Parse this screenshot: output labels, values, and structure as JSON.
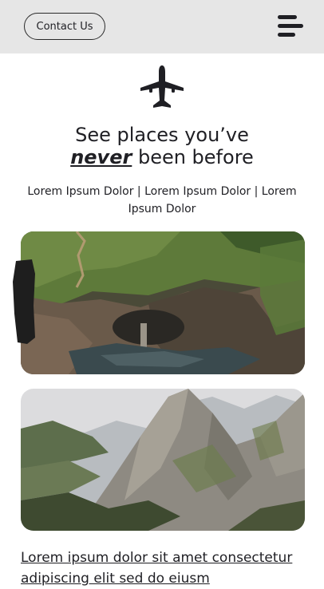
{
  "header": {
    "contact_label": "Contact Us",
    "menu_icon": "hamburger-menu-icon",
    "background": "#e6e6e6"
  },
  "hero": {
    "icon": "airplane-icon",
    "title_line1": "See places you’ve",
    "title_emphasis": "never",
    "title_rest": "been before",
    "subtitle": "Lorem Ipsum Dolor | Lorem Ipsum Dolor | Lorem Ipsum Dolor"
  },
  "gallery": {
    "images": [
      {
        "name": "coastal-cliff-photo"
      },
      {
        "name": "mountain-peak-photo"
      }
    ]
  },
  "article": {
    "link_line1": "Lorem ipsum dolor sit amet consectetur",
    "link_line2": "adipiscing elit sed do eiusm"
  },
  "colors": {
    "text": "#1f1f24",
    "accent": "#2a2a2a"
  }
}
